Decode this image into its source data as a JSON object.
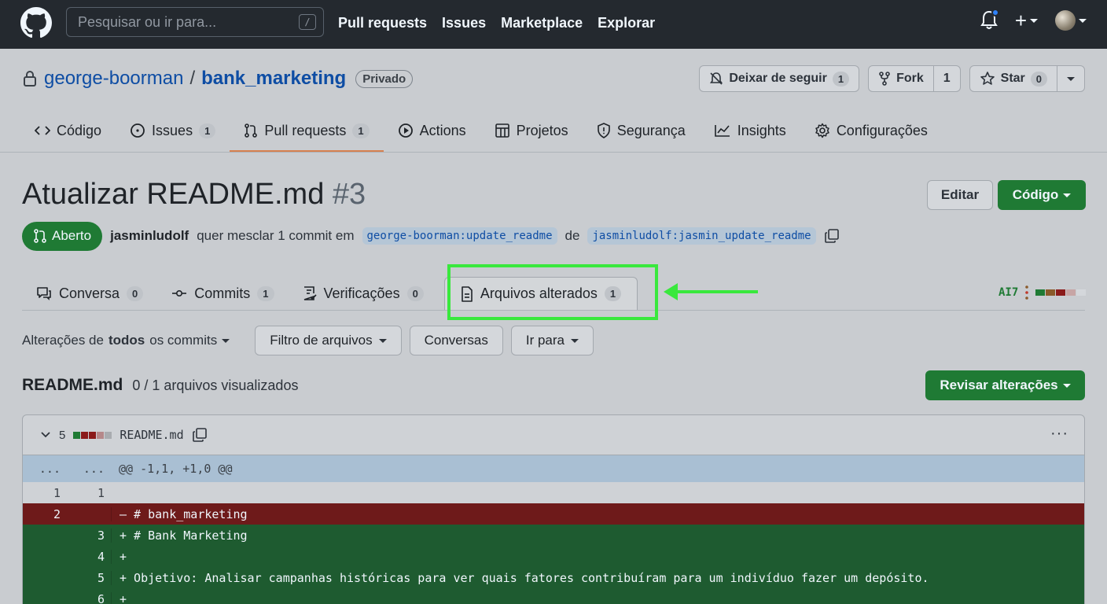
{
  "header": {
    "search_placeholder": "Pesquisar ou ir para...",
    "search_shortcut": "/",
    "nav": [
      "Pull requests",
      "Issues",
      "Marketplace",
      "Explorar"
    ],
    "plus_label": "+"
  },
  "repo": {
    "owner": "george-boorman",
    "separator": "/",
    "name": "bank_marketing",
    "visibility": "Privado",
    "watch": {
      "label": "Deixar de seguir",
      "count": "1"
    },
    "fork": {
      "label": "Fork",
      "count": "1"
    },
    "star": {
      "label": "Star",
      "count": "0"
    }
  },
  "repo_tabs": [
    {
      "label": "Código",
      "count": null
    },
    {
      "label": "Issues",
      "count": "1"
    },
    {
      "label": "Pull requests",
      "count": "1"
    },
    {
      "label": "Actions",
      "count": null
    },
    {
      "label": "Projetos",
      "count": null
    },
    {
      "label": "Segurança",
      "count": null
    },
    {
      "label": "Insights",
      "count": null
    },
    {
      "label": "Configurações",
      "count": null
    }
  ],
  "pr": {
    "title": "Atualizar README.md",
    "number": "#3",
    "edit_label": "Editar",
    "code_label": "Código",
    "state": "Aberto",
    "author": "jasminludolf",
    "merge_text": "quer mesclar 1 commit em",
    "base_branch": "george-boorman:update_readme",
    "from_text": "de",
    "head_branch": "jasminludolf:jasmin_update_readme"
  },
  "pr_tabs": [
    {
      "label": "Conversa",
      "count": "0"
    },
    {
      "label": "Commits",
      "count": "1"
    },
    {
      "label": "Verificações",
      "count": "0"
    },
    {
      "label": "Arquivos alterados",
      "count": "1"
    }
  ],
  "diffstat_text": "AI7",
  "filters": {
    "changes_prefix": "Alterações de",
    "changes_bold": "todos",
    "changes_suffix": "os commits",
    "file_filter": "Filtro de arquivos",
    "conversations": "Conversas",
    "jump_to": "Ir para"
  },
  "files_summary": {
    "filename": "README.md",
    "viewed": "0 / 1 arquivos visualizados",
    "review_label": "Revisar alterações"
  },
  "diff": {
    "changes_count": "5",
    "filename": "README.md",
    "more": "···",
    "lines": [
      {
        "type": "hunk",
        "old": "...",
        "new": "...",
        "text": "@@ -1,1, +1,0 @@"
      },
      {
        "type": "ctx",
        "old": "1",
        "new": "1",
        "text": ""
      },
      {
        "type": "del",
        "old": "2",
        "new": "",
        "text": "– # bank_marketing"
      },
      {
        "type": "add",
        "old": "",
        "new": "3",
        "text": "+ # Bank Marketing"
      },
      {
        "type": "add",
        "old": "",
        "new": "4",
        "text": "+"
      },
      {
        "type": "add",
        "old": "",
        "new": "5",
        "text": "+ Objetivo: Analisar campanhas históricas para ver quais fatores contribuíram para um indivíduo fazer um depósito."
      },
      {
        "type": "add",
        "old": "",
        "new": "6",
        "text": "+"
      }
    ]
  },
  "colors": {
    "accent_green": "#1f7a34",
    "highlight": "#39e83d",
    "link": "#0e4da4"
  }
}
